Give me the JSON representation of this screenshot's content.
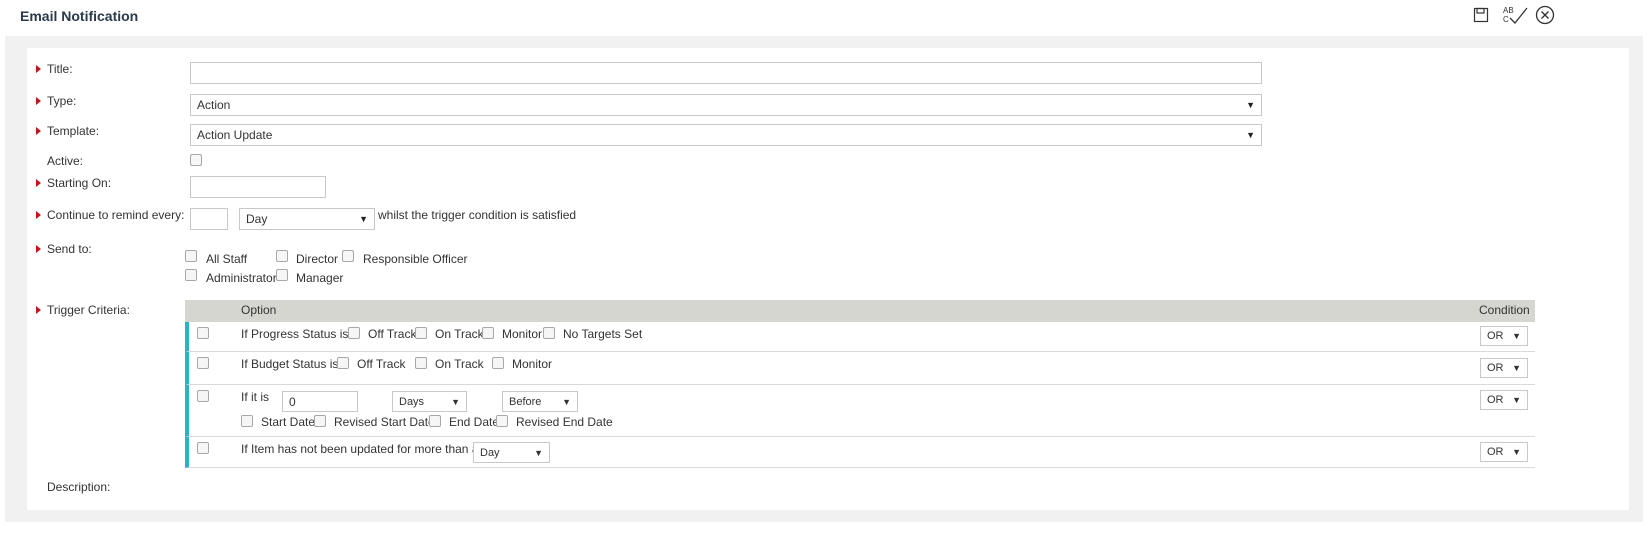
{
  "header": {
    "title": "Email Notification",
    "save_icon": "save-icon",
    "spellcheck_icon": "spellcheck-icon",
    "spellcheck_text_top": "AB",
    "spellcheck_text_bottom": "C",
    "close_icon": "close-circle-icon"
  },
  "form": {
    "title_label": "Title:",
    "title_value": "",
    "type_label": "Type:",
    "type_value": "Action",
    "template_label": "Template:",
    "template_value": "Action Update",
    "active_label": "Active:",
    "starting_label": "Starting On:",
    "starting_value": "",
    "remind_label": "Continue to remind every:",
    "remind_value": "",
    "remind_unit": "Day",
    "remind_suffix": "whilst the trigger condition is satisfied",
    "sendto_label": "Send to:",
    "sendto_options": [
      "All Staff",
      "Director",
      "Responsible Officer",
      "Administrator",
      "Manager"
    ],
    "trigger_label": "Trigger Criteria:",
    "description_label": "Description:"
  },
  "trigger": {
    "col_option": "Option",
    "col_condition": "Condition",
    "rows": [
      {
        "text": "If Progress Status is",
        "options": [
          "Off Track",
          "On Track",
          "Monitor",
          "No Targets Set"
        ],
        "condition": "OR"
      },
      {
        "text": "If Budget Status is",
        "options": [
          "Off Track",
          "On Track",
          "Monitor"
        ],
        "condition": "OR"
      },
      {
        "text": "If it is",
        "number_value": "0",
        "unit": "Days",
        "relation": "Before",
        "options": [
          "Start Date",
          "Revised Start Date",
          "End Date",
          "Revised End Date"
        ],
        "condition": "OR"
      },
      {
        "text": "If Item has not been updated for more than a",
        "unit": "Day",
        "condition": "OR"
      }
    ]
  },
  "colors": {
    "marker": "#c0161c",
    "row_accent": "#28b4c8",
    "table_header": "#d6d6d0"
  }
}
